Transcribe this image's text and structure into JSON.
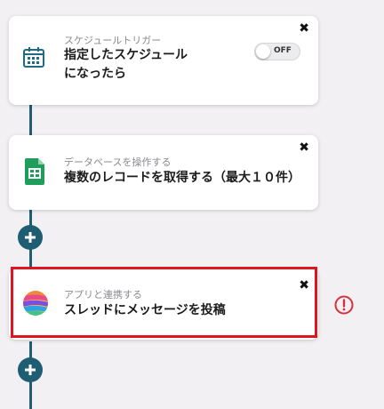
{
  "steps": [
    {
      "subtitle": "スケジュールトリガー",
      "title": "指定したスケジュール\nになったら",
      "icon": "schedule-calendar-icon",
      "toggle_label": "OFF"
    },
    {
      "subtitle": "データベースを操作する",
      "title": "複数のレコードを取得する（最大１０件）",
      "icon": "google-sheets-icon"
    },
    {
      "subtitle": "アプリと連携する",
      "title": "スレッドにメッセージを投稿",
      "icon": "app-logo-icon"
    }
  ],
  "close_glyph": "✖",
  "colors": {
    "connector": "#1e5d72",
    "highlight": "#e0141e",
    "warning": "#d9303f",
    "sheets_green": "#1e9e5a"
  }
}
